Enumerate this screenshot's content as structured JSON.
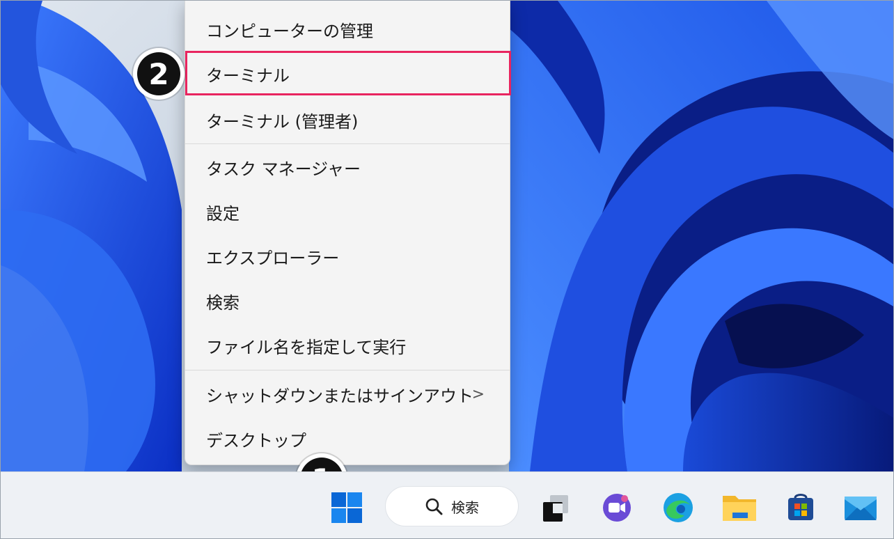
{
  "context_menu": {
    "items": [
      {
        "label": "コンピューターの管理"
      },
      {
        "label": "ターミナル"
      },
      {
        "label": "ターミナル (管理者)"
      },
      {
        "label": "タスク マネージャー"
      },
      {
        "label": "設定"
      },
      {
        "label": "エクスプローラー"
      },
      {
        "label": "検索"
      },
      {
        "label": "ファイル名を指定して実行"
      },
      {
        "label": "シャットダウンまたはサインアウト",
        "submenu": ">"
      },
      {
        "label": "デスクトップ"
      }
    ]
  },
  "annotations": {
    "step1": "1",
    "step2": "2",
    "highlight_color": "#e8245f"
  },
  "taskbar": {
    "search_label": "検索",
    "icons": [
      "start-icon",
      "search-icon",
      "task-view-icon",
      "teams-chat-icon",
      "edge-icon",
      "file-explorer-icon",
      "store-icon",
      "mail-icon"
    ]
  }
}
